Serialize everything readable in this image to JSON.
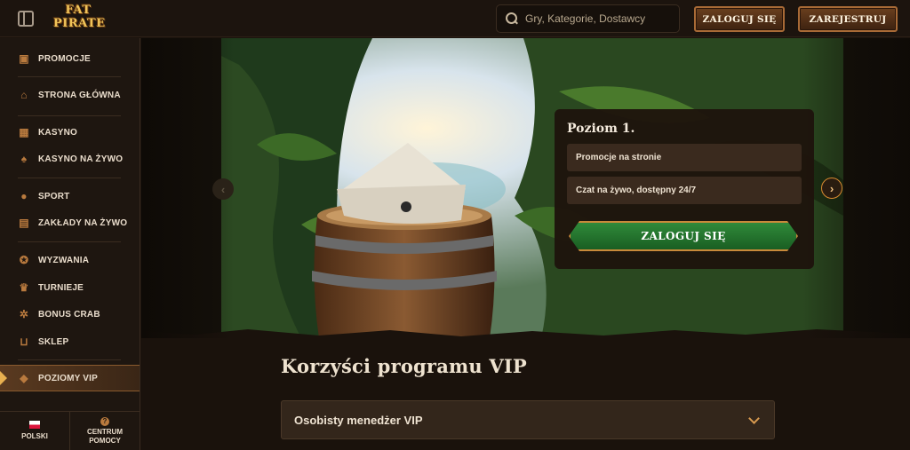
{
  "header": {
    "logo_line1": "FAT",
    "logo_line2": "PIRATE",
    "search_placeholder": "Gry, Kategorie, Dostawcy",
    "login_label": "ZALOGUJ SIĘ",
    "register_label": "ZAREJESTRUJ"
  },
  "sidebar": {
    "items": [
      {
        "label": "PROMOCJE",
        "icon": "gift-icon"
      },
      {
        "label": "STRONA GŁÓWNA",
        "icon": "home-icon"
      },
      {
        "label": "KASYNO",
        "icon": "slot-machine-icon"
      },
      {
        "label": "KASYNO NA ŻYWO",
        "icon": "cards-icon"
      },
      {
        "label": "SPORT",
        "icon": "ball-icon"
      },
      {
        "label": "ZAKŁADY NA ŻYWO",
        "icon": "live-icon"
      },
      {
        "label": "WYZWANIA",
        "icon": "medal-icon"
      },
      {
        "label": "TURNIEJE",
        "icon": "trophy-icon"
      },
      {
        "label": "BONUS CRAB",
        "icon": "crab-icon"
      },
      {
        "label": "SKLEP",
        "icon": "basket-icon"
      },
      {
        "label": "POZIOMY VIP",
        "icon": "diamond-icon"
      }
    ],
    "active_item": "POZIOMY VIP",
    "language_label": "POLSKI",
    "help_label_line1": "CENTRUM",
    "help_label_line2": "POMOCY"
  },
  "hero": {
    "card_title": "Poziom 1.",
    "perks": [
      "Promocje na stronie",
      "Czat na żywo, dostępny 24/7"
    ],
    "login_label": "ZALOGUJ SIĘ"
  },
  "main": {
    "section_title": "Korzyści programu VIP",
    "accordion_label": "Osobisty menedżer VIP"
  },
  "colors": {
    "background": "#1a120c",
    "accent": "#b97a3e",
    "cta_green": "#2f8a3a"
  }
}
